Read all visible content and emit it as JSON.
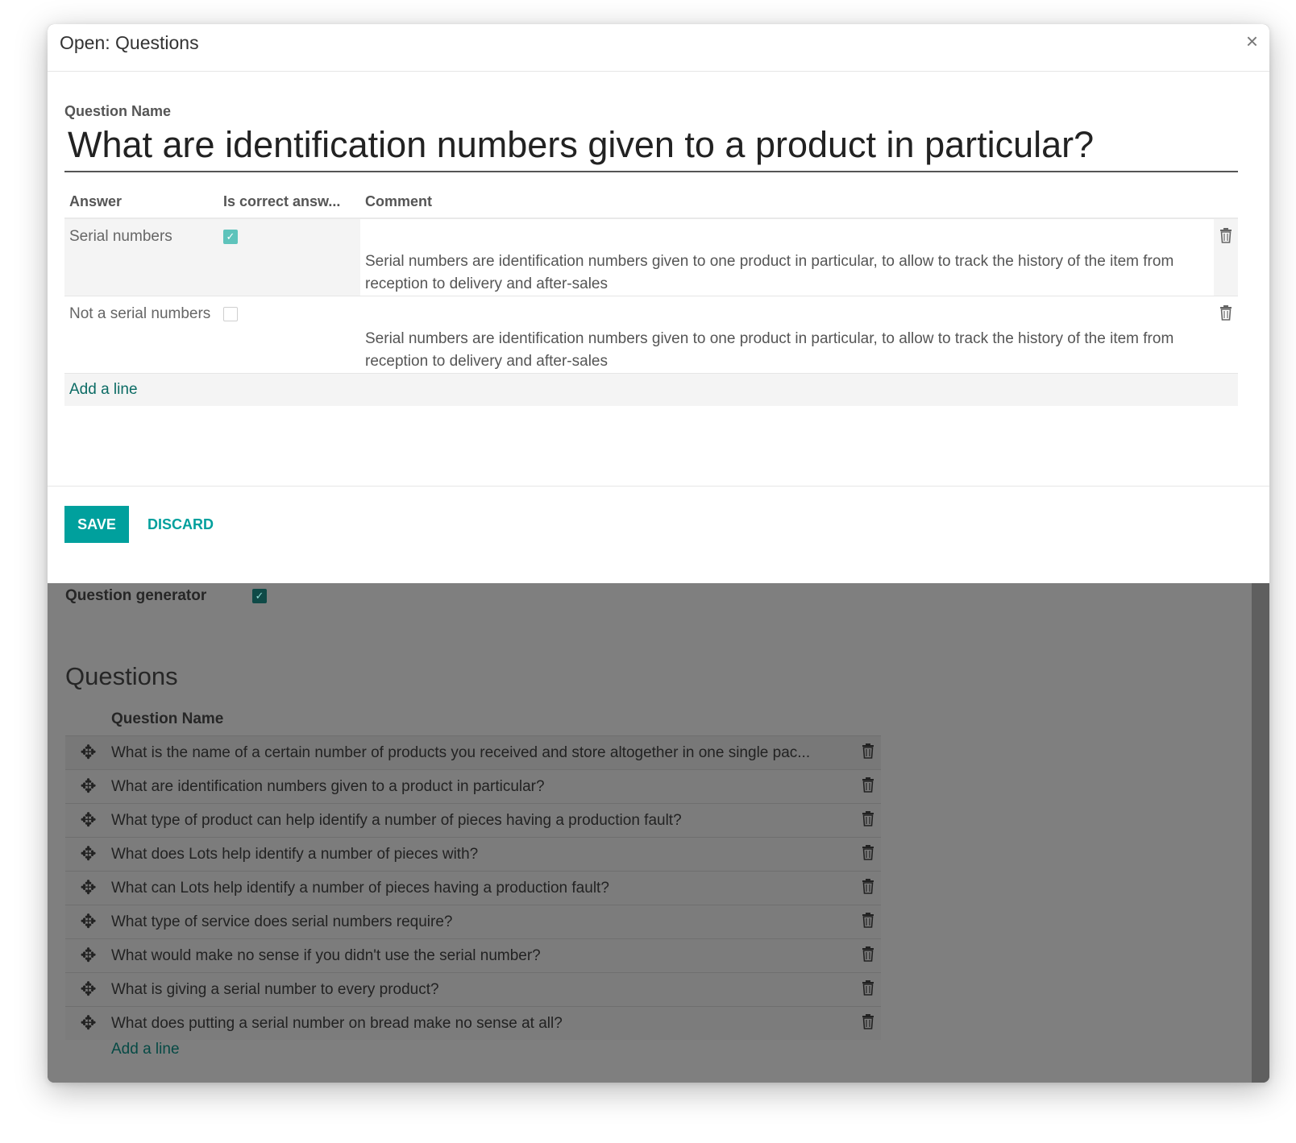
{
  "modal": {
    "title": "Open: Questions",
    "close_symbol": "×",
    "question_name_label": "Question Name",
    "question_name_value": "What are identification numbers given to a product in particular?",
    "answers_table": {
      "headers": {
        "answer": "Answer",
        "is_correct": "Is correct answ...",
        "comment": "Comment"
      },
      "rows": [
        {
          "answer": "Serial numbers",
          "is_correct": true,
          "comment": "Serial numbers are identification numbers given to one product in particular, to allow to track the history of the item from reception to delivery and after-sales"
        },
        {
          "answer": "Not a serial numbers",
          "is_correct": false,
          "comment": "Serial numbers are identification numbers given to one product in particular, to allow to track the history of the item from reception to delivery and after-sales"
        }
      ],
      "add_line_label": "Add a line"
    },
    "footer": {
      "save_label": "SAVE",
      "discard_label": "DISCARD"
    }
  },
  "background_form": {
    "question_generator_label": "Question generator",
    "question_generator_checked": true,
    "questions_section_title": "Questions",
    "questions_column_header": "Question Name",
    "questions": [
      "What is the name of a certain number of products you received and store altogether in one single pac...",
      "What are identification numbers given to a product in particular?",
      "What type of product can help identify a number of pieces having a production fault?",
      "What does Lots help identify a number of pieces with?",
      "What can Lots help identify a number of pieces having a production fault?",
      "What type of service does serial numbers require?",
      "What would make no sense if you didn't use the serial number?",
      "What is giving a serial number to every product?",
      "What does putting a serial number on bread make no sense at all?"
    ],
    "add_line_label": "Add a line"
  },
  "icons": {
    "trash": "trash-icon",
    "drag_handle": "drag-handle-icon",
    "checkmark": "checkmark-icon",
    "close": "close-icon"
  },
  "colors": {
    "primary": "#00a09d",
    "checkbox_checked": "#5ec3bb",
    "overlay": "#7f7f7f",
    "link_dark": "#064a45"
  }
}
